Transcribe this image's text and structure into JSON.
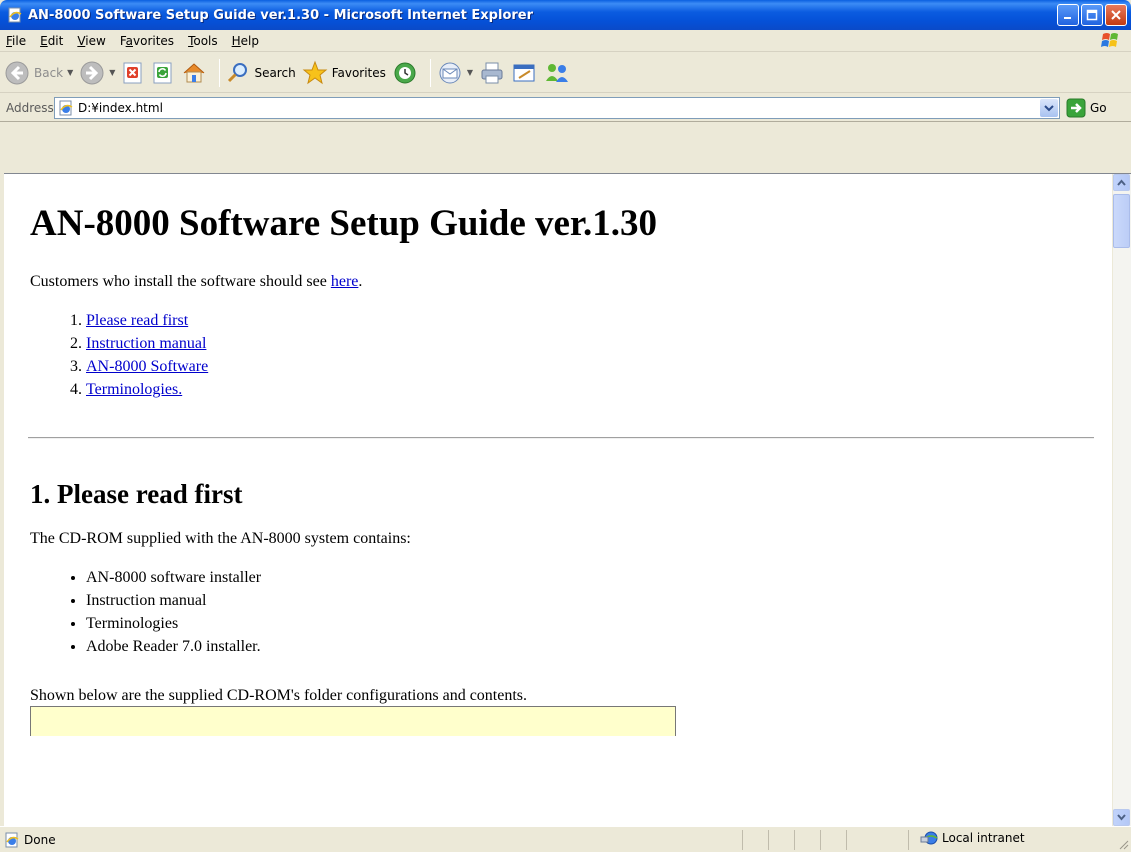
{
  "window": {
    "title": "AN-8000 Software Setup Guide ver.1.30 - Microsoft Internet Explorer",
    "app_icon": "ie-page-icon",
    "controls": [
      "minimize-icon",
      "maximize-icon",
      "close-icon"
    ]
  },
  "menu": {
    "items": [
      {
        "label": "File",
        "key": "F",
        "rest": "ile"
      },
      {
        "label": "Edit",
        "key": "E",
        "rest": "dit"
      },
      {
        "label": "View",
        "key": "V",
        "rest": "iew"
      },
      {
        "label": "Favorites",
        "key": "a",
        "pre": "F",
        "rest": "vorites"
      },
      {
        "label": "Tools",
        "key": "T",
        "rest": "ools"
      },
      {
        "label": "Help",
        "key": "H",
        "rest": "elp"
      }
    ]
  },
  "toolbar": {
    "back_label": "Back",
    "search_label": "Search",
    "favorites_label": "Favorites"
  },
  "address": {
    "label": "Address",
    "value": "D:¥index.html",
    "go_label": "Go"
  },
  "page": {
    "title": "AN-8000 Software Setup Guide ver.1.30",
    "intro_text": "Customers who install the software should see ",
    "intro_link": "here",
    "intro_end": ".",
    "toc": [
      "Please read first",
      "Instruction manual",
      "AN-8000 Software",
      "Terminologies."
    ],
    "section1_heading": "1. Please read first",
    "section1_text": "The CD-ROM supplied with the AN-8000 system contains:",
    "contents": [
      "AN-8000 software installer",
      "Instruction manual",
      "Terminologies",
      "Adobe Reader 7.0 installer."
    ],
    "folder_text": "Shown below are the supplied CD-ROM's folder configurations and contents."
  },
  "status": {
    "text": "Done",
    "zone": "Local intranet"
  },
  "colors": {
    "titlebar": "#0551d8",
    "link": "#0000cc",
    "chrome": "#ece9d8",
    "highlight_box": "#ffffcc"
  }
}
